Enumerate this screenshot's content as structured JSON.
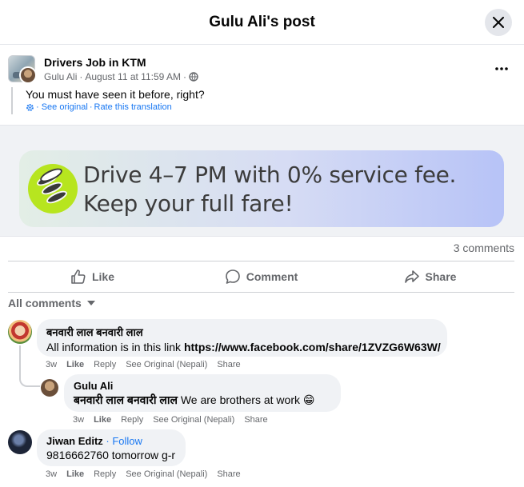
{
  "header": {
    "title": "Gulu Ali's post",
    "close_icon": "close-icon"
  },
  "post": {
    "page_name": "Drivers Job in KTM",
    "author": "Gulu Ali",
    "date": "August 11 at 11:59 AM",
    "separator": "·",
    "audience_icon": "globe-icon",
    "more_icon": "more-icon",
    "text": "You must have seen it before, right?",
    "see_original": "· See original",
    "rate_translation": "Rate this translation",
    "translate_icon": "gear-icon"
  },
  "media": {
    "line1": "Drive 4–7 PM with 0% service fee.",
    "line2": "Keep your full fare!",
    "colors": {
      "icon_bg": "#b7e51f",
      "card_start": "#e3eee6",
      "card_end": "#b7c3f7"
    }
  },
  "stats": {
    "comments_count": "3 comments"
  },
  "actions": {
    "like": "Like",
    "comment": "Comment",
    "share": "Share"
  },
  "filter": {
    "label": "All comments"
  },
  "comments": [
    {
      "name": "बनवारी लाल बनवारी लाल",
      "text": "All information is in this link ",
      "link": "https://www.facebook.com/share/1ZVZG6W63W/",
      "time": "3w",
      "like": "Like",
      "reply": "Reply",
      "see_original": "See Original (Nepali)",
      "share": "Share"
    },
    {
      "name": "Gulu Ali",
      "mention": "बनवारी लाल बनवारी लाल",
      "text": " We are brothers at work 😁",
      "time": "3w",
      "like": "Like",
      "reply": "Reply",
      "see_original": "See Original (Nepali)",
      "share": "Share"
    },
    {
      "name": "Jiwan Editz",
      "follow": "· Follow",
      "text": "9816662760 tomorrow g-r",
      "time": "3w",
      "like": "Like",
      "reply": "Reply",
      "see_original": "See Original (Nepali)",
      "share": "Share"
    }
  ]
}
